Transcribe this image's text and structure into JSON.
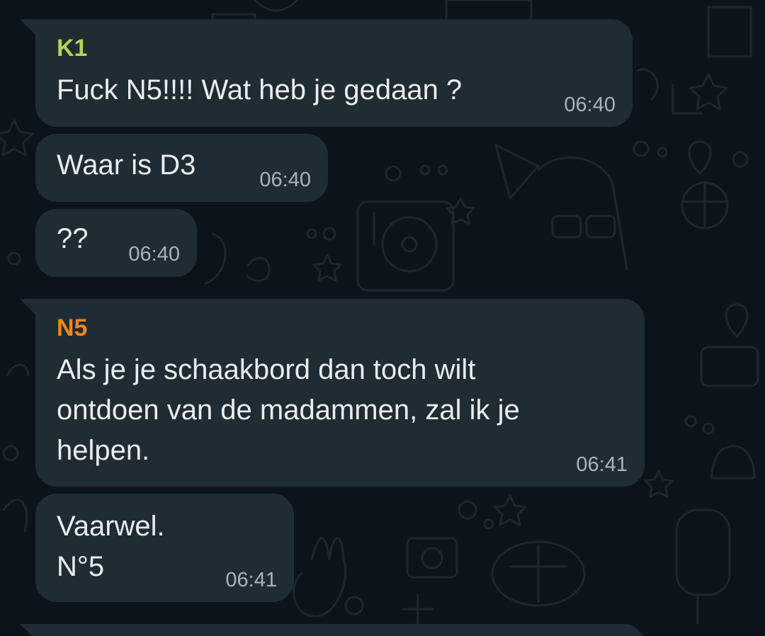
{
  "colors": {
    "background": "#0b141a",
    "bubble": "#202c33",
    "text": "#e9edef",
    "time": "#aab3b8",
    "sender_k1": "#b6d15a",
    "sender_n5": "#f0861d"
  },
  "messages": [
    {
      "sender": "K1",
      "text": "Fuck N5!!!! Wat heb je gedaan ?",
      "time": "06:40"
    },
    {
      "sender": "",
      "text": "Waar is D3",
      "time": "06:40"
    },
    {
      "sender": "",
      "text": "??",
      "time": "06:40"
    },
    {
      "sender": "N5",
      "text": "Als je je schaakbord dan toch wilt\nontdoen van de madammen, zal ik je\nhelpen.",
      "time": "06:41"
    },
    {
      "sender": "",
      "text": "Vaarwel.\nN°5",
      "time": "06:41"
    }
  ]
}
